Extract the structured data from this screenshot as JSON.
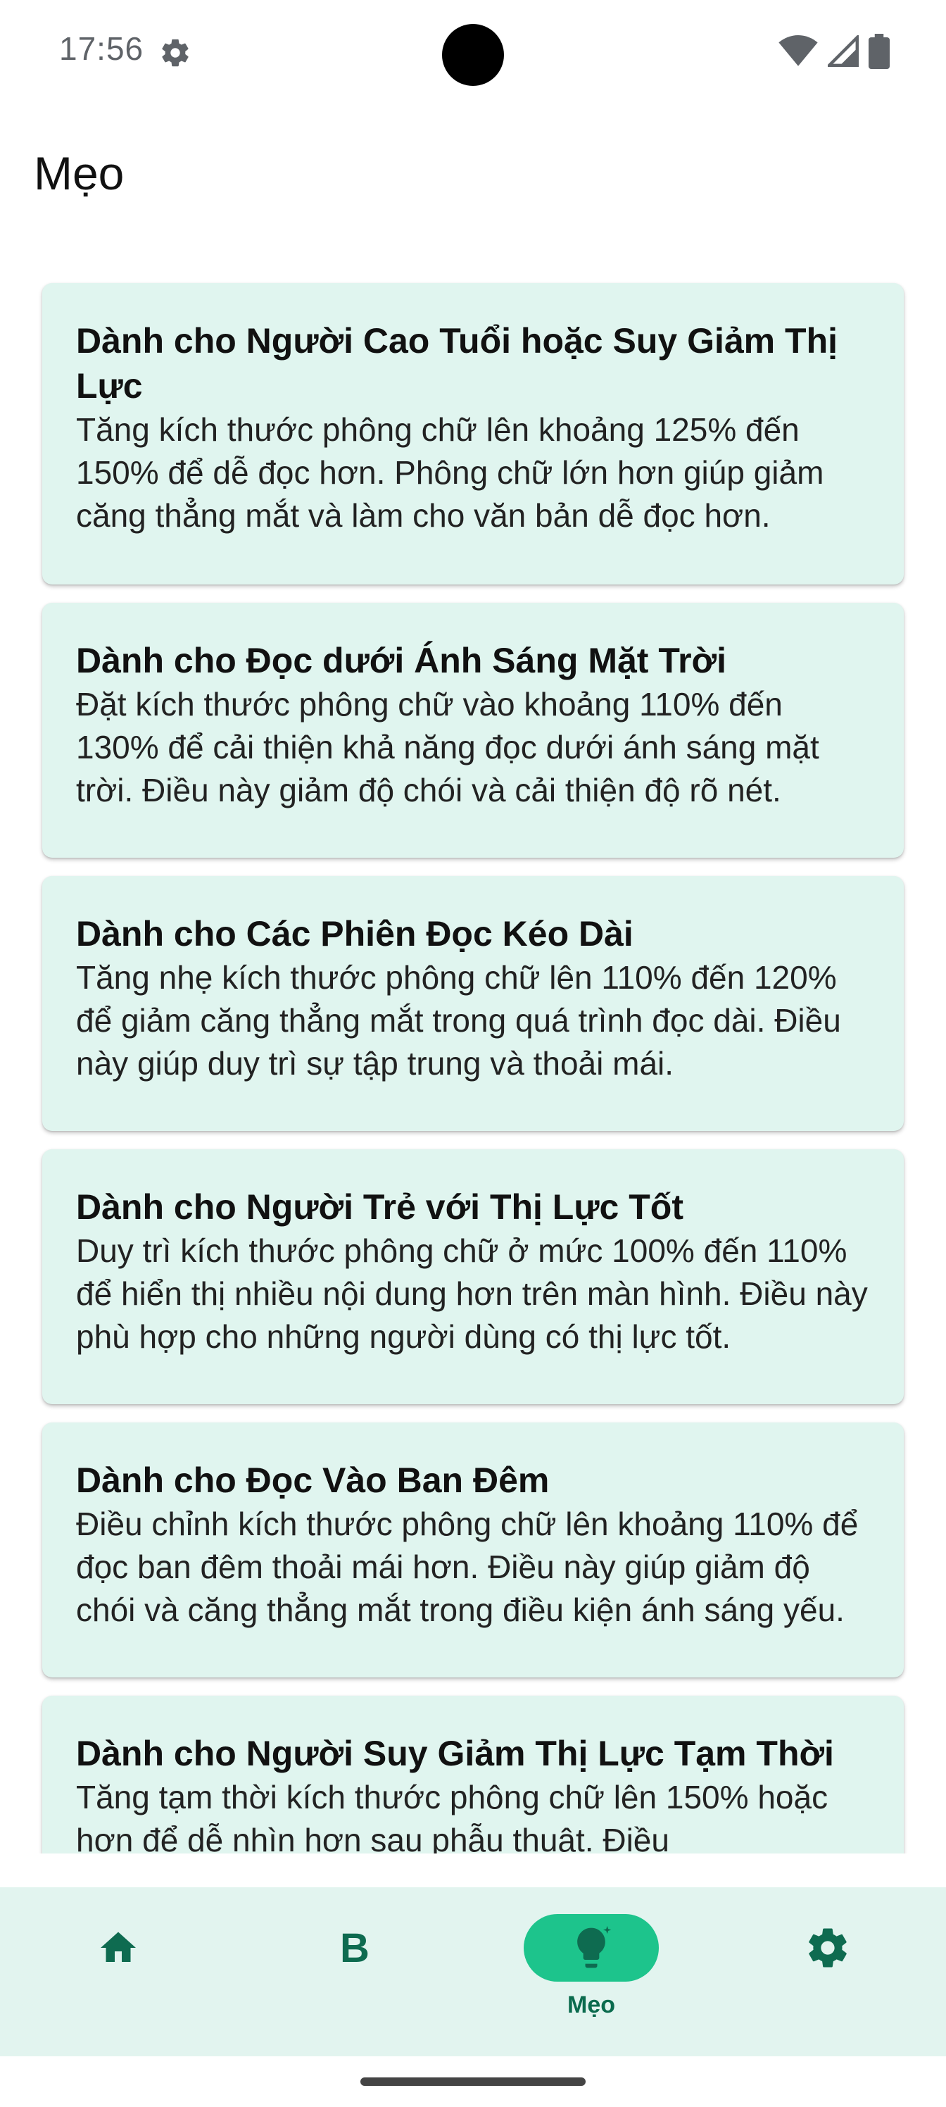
{
  "status_bar": {
    "time": "17:56",
    "icons": [
      "settings-gear-icon",
      "wifi-icon",
      "signal-icon",
      "battery-icon"
    ]
  },
  "page": {
    "title": "Mẹo"
  },
  "tips": [
    {
      "title": "Dành cho Người Cao Tuổi hoặc Suy Giảm Thị Lực",
      "body": "Tăng kích thước phông chữ lên khoảng 125% đến 150% để dễ đọc hơn. Phông chữ lớn hơn giúp giảm căng thẳng mắt và làm cho văn bản dễ đọc hơn."
    },
    {
      "title": "Dành cho Đọc dưới Ánh Sáng Mặt Trời",
      "body": "Đặt kích thước phông chữ vào khoảng 110% đến 130% để cải thiện khả năng đọc dưới ánh sáng mặt trời. Điều này giảm độ chói và cải thiện độ rõ nét."
    },
    {
      "title": "Dành cho Các Phiên Đọc Kéo Dài",
      "body": "Tăng nhẹ kích thước phông chữ lên 110% đến 120% để giảm căng thẳng mắt trong quá trình đọc dài. Điều này giúp duy trì sự tập trung và thoải mái."
    },
    {
      "title": "Dành cho Người Trẻ với Thị Lực Tốt",
      "body": "Duy trì kích thước phông chữ ở mức 100% đến 110% để hiển thị nhiều nội dung hơn trên màn hình. Điều này phù hợp cho những người dùng có thị lực tốt."
    },
    {
      "title": "Dành cho Đọc Vào Ban Đêm",
      "body": "Điều chỉnh kích thước phông chữ lên khoảng 110% để đọc ban đêm thoải mái hơn. Điều này giúp giảm độ chói và căng thẳng mắt trong điều kiện ánh sáng yếu."
    },
    {
      "title": "Dành cho Người Suy Giảm Thị Lực Tạm Thời",
      "body": "Tăng tạm thời kích thước phông chữ lên 150% hoặc hơn để dễ nhìn hơn sau phẫu thuật. Điều"
    }
  ],
  "bottom_nav": {
    "items": [
      {
        "icon": "home-icon",
        "label": ""
      },
      {
        "icon": "b-letter-icon",
        "glyph": "B",
        "label": ""
      },
      {
        "icon": "lightbulb-icon",
        "label": "Mẹo",
        "active": true
      },
      {
        "icon": "settings-icon",
        "label": ""
      }
    ]
  },
  "colors": {
    "card_background": "#e0f5ef",
    "nav_background": "#e2f4ef",
    "active_pill": "#1dc48c",
    "icon_green": "#0e6b50"
  }
}
